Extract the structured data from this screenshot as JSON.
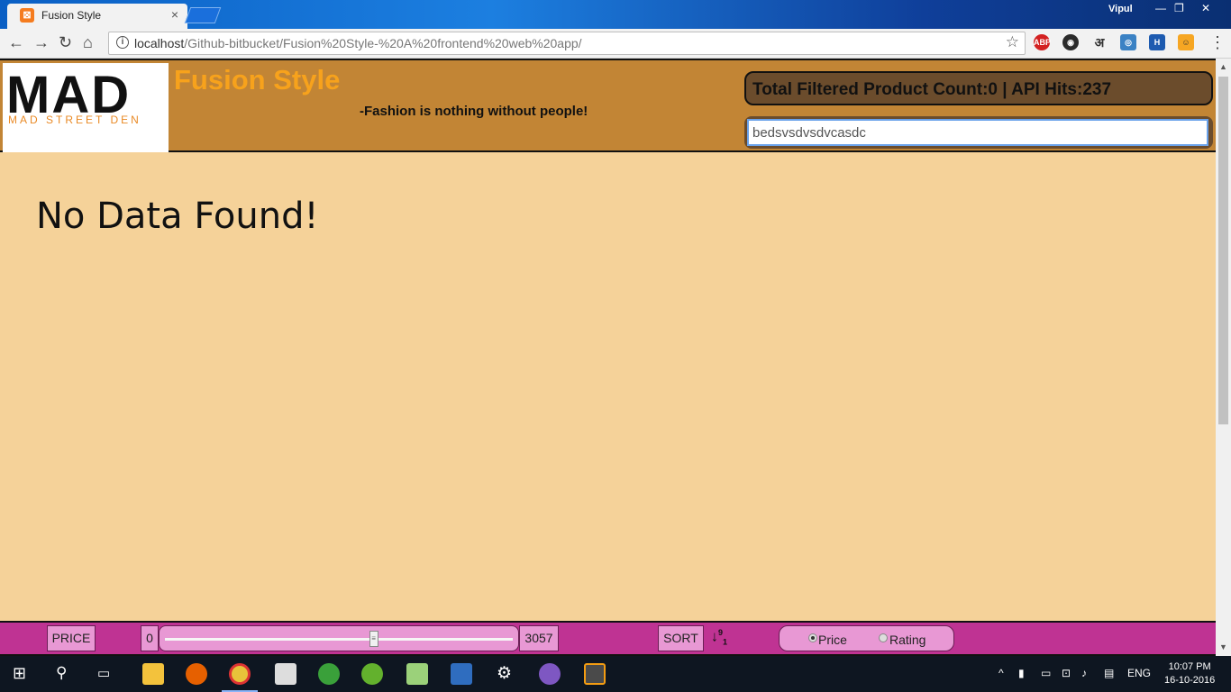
{
  "browser": {
    "tab_title": "Fusion Style",
    "tab_close": "×",
    "profile_name": "Vipul",
    "url_host": "localhost",
    "url_path": "/Github-bitbucket/Fusion%20Style-%20A%20frontend%20web%20app/",
    "extensions": [
      "ABP",
      "अ"
    ]
  },
  "header": {
    "logo_big": "MAD",
    "logo_small": "MAD STREET DEN",
    "brand": "Fusion Style",
    "tagline": "-Fashion is nothing without people!",
    "count_text": "Total Filtered Product Count:0 | API Hits:237",
    "search_value": "bedsvsdvsdvcasdc"
  },
  "main": {
    "message": "No Data Found!"
  },
  "filters": {
    "price_label": "PRICE",
    "price_min": "0",
    "price_max": "3057",
    "slider_value_fraction": 0.6,
    "sort_label": "SORT",
    "sort_icon": "sort-numeric-desc-icon",
    "radio_price": "Price",
    "radio_rating": "Rating",
    "radio_selected": "Price"
  },
  "taskbar": {
    "language": "ENG",
    "time": "10:07 PM",
    "date": "16-10-2016"
  },
  "colors": {
    "header_bg": "#c28535",
    "page_bg": "#f5d299",
    "brand_orange": "#f7a21c",
    "bottom_bar": "#bf3393",
    "pill_pink": "#e898d4"
  }
}
